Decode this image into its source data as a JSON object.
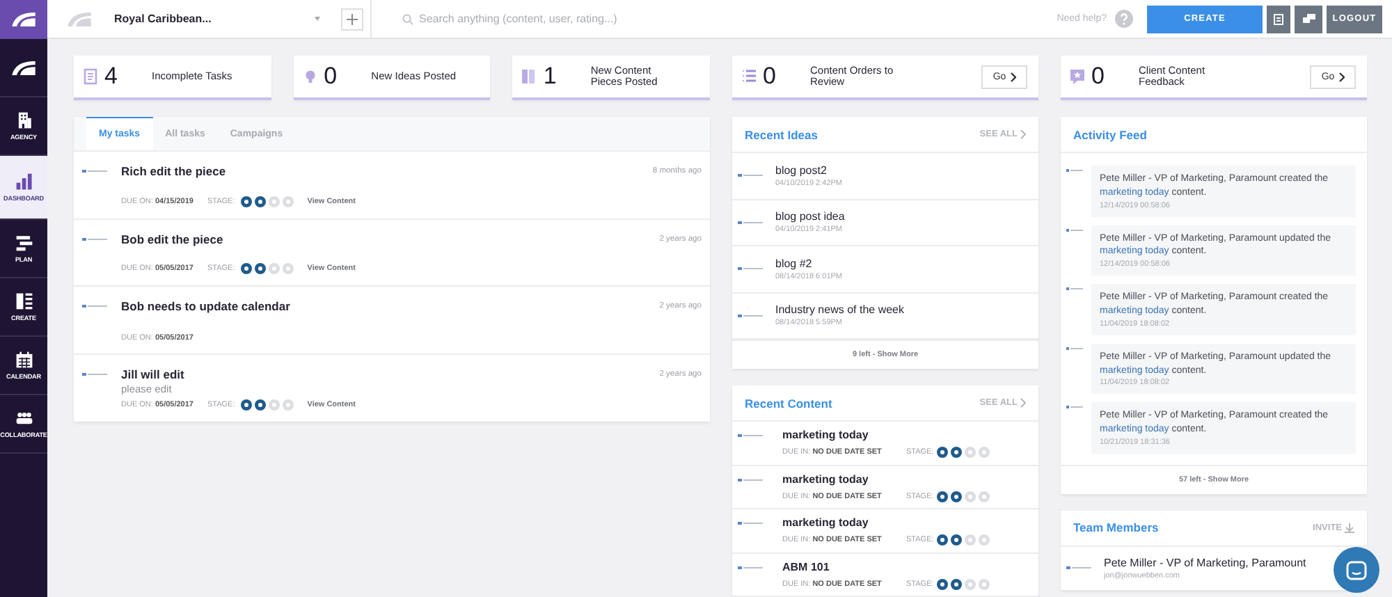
{
  "sidebar": {
    "items": [
      {
        "label": "AGENCY",
        "kind": "agency",
        "selected": false
      },
      {
        "label": "DASHBOARD",
        "kind": "dashboard",
        "selected": true
      },
      {
        "label": "PLAN",
        "kind": "plan",
        "selected": false
      },
      {
        "label": "CREATE",
        "kind": "create",
        "selected": false
      },
      {
        "label": "CALENDAR",
        "kind": "calendar",
        "selected": false
      },
      {
        "label": "COLLABORATE",
        "kind": "collaborate",
        "selected": false
      }
    ]
  },
  "topbar": {
    "workspace": "Royal Caribbean...",
    "search": {
      "placeholder": "Search anything (content, user, rating...)"
    },
    "help": "Need help?",
    "buttons": [
      {
        "kind": "primary",
        "label": "CREATE"
      },
      {
        "kind": "doc"
      },
      {
        "kind": "chat"
      },
      {
        "kind": "secondary",
        "label": "LOGOUT"
      }
    ]
  },
  "stats": [
    {
      "kind": "tasks",
      "count": "4",
      "label": "Incomplete Tasks"
    },
    {
      "kind": "ideas",
      "count": "0",
      "label": "New Ideas Posted"
    },
    {
      "kind": "pieces",
      "count": "1",
      "label": "New Content Pieces Posted"
    },
    {
      "kind": "orders",
      "count": "0",
      "label": "Content Orders to Review",
      "action": "Go"
    },
    {
      "kind": "feedback",
      "count": "0",
      "label": "Client Content Feedback",
      "action": "Go"
    }
  ],
  "tasks": {
    "tabs": [
      {
        "label": "My tasks",
        "selected": true
      },
      {
        "label": "All tasks",
        "selected": false
      },
      {
        "label": "Campaigns",
        "selected": false
      }
    ],
    "items": [
      {
        "title": "Rich edit the piece",
        "due_label": "DUE ON:",
        "due": "04/15/2019",
        "stage_label": "STAGE:",
        "stages": [
          {
            "done": true
          },
          {
            "done": true
          },
          {
            "done": false
          },
          {
            "done": false
          }
        ],
        "link": "View Content",
        "time": "8 months ago"
      },
      {
        "title": "Bob edit the piece",
        "due_label": "DUE ON:",
        "due": "05/05/2017",
        "stage_label": "STAGE:",
        "stages": [
          {
            "done": true
          },
          {
            "done": true
          },
          {
            "done": false
          },
          {
            "done": false
          }
        ],
        "link": "View Content",
        "time": "2 years ago"
      },
      {
        "title": "Bob needs to update calendar",
        "due_label": "DUE ON:",
        "due": "05/05/2017",
        "time": "2 years ago"
      },
      {
        "title": "Jill will edit",
        "note": "please edit",
        "due_label": "DUE ON:",
        "due": "05/05/2017",
        "stage_label": "STAGE:",
        "stages": [
          {
            "done": true
          },
          {
            "done": true
          },
          {
            "done": false
          },
          {
            "done": false
          }
        ],
        "link": "View Content",
        "time": "2 years ago"
      }
    ]
  },
  "recent_ideas": {
    "title": "Recent Ideas",
    "see_all": "SEE ALL",
    "items": [
      {
        "title": "blog post2",
        "time": "04/10/2019 2:42PM"
      },
      {
        "title": "blog post idea",
        "time": "04/10/2019 2:41PM"
      },
      {
        "title": "blog #2",
        "time": "08/14/2018 6:01PM"
      },
      {
        "title": "Industry news of the week",
        "time": "08/14/2018 5:59PM"
      }
    ],
    "footer": "9 left - Show More"
  },
  "recent_content": {
    "title": "Recent Content",
    "see_all": "SEE ALL",
    "items": [
      {
        "title": "marketing today",
        "due_label": "DUE IN:",
        "due": "NO DUE DATE SET",
        "stage_label": "STAGE:",
        "stages": [
          {
            "done": true
          },
          {
            "done": true
          },
          {
            "done": false
          },
          {
            "done": false
          }
        ]
      },
      {
        "title": "marketing today",
        "due_label": "DUE IN:",
        "due": "NO DUE DATE SET",
        "stage_label": "STAGE:",
        "stages": [
          {
            "done": true
          },
          {
            "done": true
          },
          {
            "done": false
          },
          {
            "done": false
          }
        ]
      },
      {
        "title": "marketing today",
        "due_label": "DUE IN:",
        "due": "NO DUE DATE SET",
        "stage_label": "STAGE:",
        "stages": [
          {
            "done": true
          },
          {
            "done": true
          },
          {
            "done": false
          },
          {
            "done": false
          }
        ]
      },
      {
        "title": "ABM 101",
        "due_label": "DUE IN:",
        "due": "NO DUE DATE SET",
        "stage_label": "STAGE:",
        "stages": [
          {
            "done": true
          },
          {
            "done": true
          },
          {
            "done": false
          },
          {
            "done": false
          }
        ]
      }
    ]
  },
  "activity_feed": {
    "title": "Activity Feed",
    "items": [
      {
        "before": "Pete Miller - VP of Marketing, Paramount created the",
        "link": "marketing today",
        "after": "content.",
        "time": "12/14/2019 00:58:06"
      },
      {
        "before": "Pete Miller - VP of Marketing, Paramount updated the",
        "link": "marketing today",
        "after": "content.",
        "time": "12/14/2019 00:58:06"
      },
      {
        "before": "Pete Miller - VP of Marketing, Paramount created the",
        "link": "marketing today",
        "after": "content.",
        "time": "11/04/2019 18:08:02"
      },
      {
        "before": "Pete Miller - VP of Marketing, Paramount updated the",
        "link": "marketing today",
        "after": "content.",
        "time": "11/04/2019 18:08:02"
      },
      {
        "before": "Pete Miller - VP of Marketing, Paramount created the",
        "link": "marketing today",
        "after": "content.",
        "time": "10/21/2019 18:31:36"
      }
    ],
    "footer": "57 left - Show More"
  },
  "team_members": {
    "title": "Team Members",
    "action": "INVITE",
    "members": [
      {
        "name": "Pete Miller - VP of Marketing, Paramount",
        "email": "jon@jonwuebben.com"
      }
    ]
  }
}
